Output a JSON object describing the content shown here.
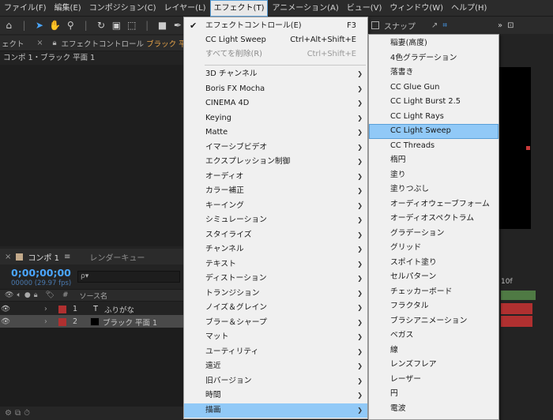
{
  "menubar": [
    {
      "label": "ファイル(F)"
    },
    {
      "label": "編集(E)"
    },
    {
      "label": "コンポジション(C)"
    },
    {
      "label": "レイヤー(L)"
    },
    {
      "label": "エフェクト(T)",
      "active": true
    },
    {
      "label": "アニメーション(A)"
    },
    {
      "label": "ビュー(V)"
    },
    {
      "label": "ウィンドウ(W)"
    },
    {
      "label": "ヘルプ(H)"
    }
  ],
  "toolbar_right": {
    "snap_label": "スナップ"
  },
  "left_panel": {
    "tab_partial": "ェクト",
    "tab_effect_controls": "エフェクトコントロール",
    "tab_effect_target": "ブラック 平",
    "comp_crumb": "コンポ 1・ブラック 平面 1"
  },
  "timeline": {
    "tab_comp": "コンポ 1",
    "tab_render": "レンダーキュー",
    "timecode": "0;00;00;00",
    "fps": "00000 (29.97 fps)",
    "search_placeholder": "ρ▾",
    "header_hash": "#",
    "header_source": "ソース名",
    "ruler_label": "10f",
    "layers": [
      {
        "num": "1",
        "type": "T",
        "name": "ふりがな",
        "selected": false
      },
      {
        "num": "2",
        "type": "",
        "name": "ブラック 平面 1",
        "selected": true
      }
    ]
  },
  "effect_menu": {
    "items": [
      {
        "label": "エフェクトコントロール(E)",
        "shortcut": "F3",
        "check": true
      },
      {
        "label": "CC Light Sweep",
        "shortcut": "Ctrl+Alt+Shift+E"
      },
      {
        "label": "すべてを削除(R)",
        "shortcut": "Ctrl+Shift+E",
        "disabled": true
      }
    ],
    "categories": [
      "3D チャンネル",
      "Boris FX Mocha",
      "CINEMA 4D",
      "Keying",
      "Matte",
      "イマーシブビデオ",
      "エクスプレッション制御",
      "オーディオ",
      "カラー補正",
      "キーイング",
      "シミュレーション",
      "スタイライズ",
      "チャンネル",
      "テキスト",
      "ディストーション",
      "トランジション",
      "ノイズ＆グレイン",
      "ブラー＆シャープ",
      "マット",
      "ユーティリティ",
      "遠近",
      "旧バージョン",
      "時間",
      "描画"
    ],
    "highlighted_category": "描画"
  },
  "draw_submenu": {
    "items": [
      "稲妻(高度)",
      "4色グラデーション",
      "落書き",
      "CC Glue Gun",
      "CC Light Burst 2.5",
      "CC Light Rays",
      "CC Light Sweep",
      "CC Threads",
      "楕円",
      "塗り",
      "塗りつぶし",
      "オーディオウェーブフォーム",
      "オーディオスペクトラム",
      "グラデーション",
      "グリッド",
      "スポイト塗り",
      "セルパターン",
      "チェッカーボード",
      "フラクタル",
      "ブラシアニメーション",
      "ベガス",
      "線",
      "レンズフレア",
      "レーザー",
      "円",
      "電波"
    ],
    "highlighted": "CC Light Sweep"
  }
}
